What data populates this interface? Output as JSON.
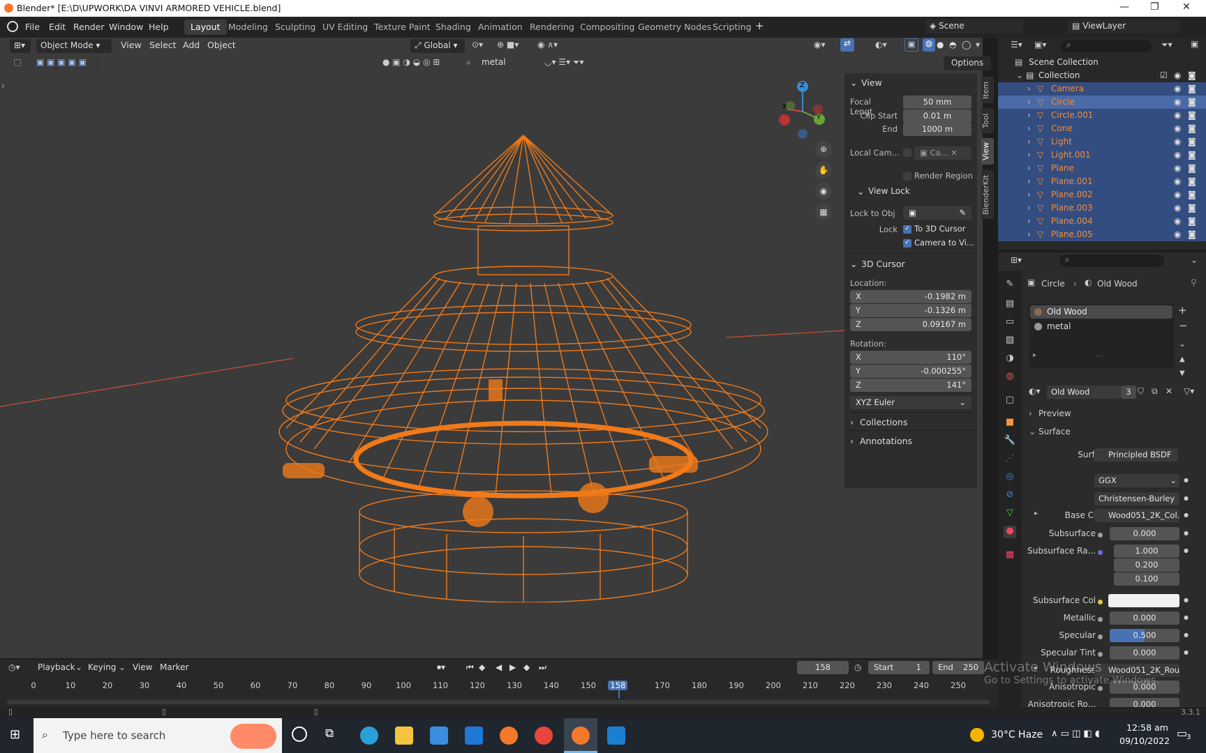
{
  "window": {
    "title": "Blender* [E:\\D\\UPWORK\\DA VINVI ARMORED VEHICLE.blend]"
  },
  "menu": [
    "File",
    "Edit",
    "Render",
    "Window",
    "Help"
  ],
  "workspaces": [
    "Layout",
    "Modeling",
    "Sculpting",
    "UV Editing",
    "Texture Paint",
    "Shading",
    "Animation",
    "Rendering",
    "Compositing",
    "Geometry Nodes",
    "Scripting"
  ],
  "scene": {
    "name": "Scene",
    "view_layer": "ViewLayer"
  },
  "viewport_header": {
    "mode": "Object Mode",
    "view": "View",
    "select": "Select",
    "add": "Add",
    "object": "Object",
    "orientation": "Global",
    "options": "Options",
    "search_value": "metal"
  },
  "npanel": {
    "view_title": "View",
    "focal_label": "Focal Lengt",
    "focal": "50 mm",
    "clip_start_label": "Clip Start",
    "clip_start": "0.01 m",
    "end_label": "End",
    "end": "1000 m",
    "local_cam_label": "Local Cam...",
    "local_cam_value": "Ca...",
    "render_region": "Render Region",
    "view_lock_title": "View Lock",
    "lock_obj_label": "Lock to Obj",
    "lock_label": "Lock",
    "to_3d_cursor": "To 3D Cursor",
    "camera_to_view": "Camera to Vi...",
    "cursor_title": "3D Cursor",
    "location_label": "Location:",
    "loc": {
      "x": "-0.1982 m",
      "y": "-0.1326 m",
      "z": "0.09167 m"
    },
    "rotation_label": "Rotation:",
    "rot": {
      "x": "110°",
      "y": "-0.000255°",
      "z": "141°"
    },
    "rot_mode": "XYZ Euler",
    "collections": "Collections",
    "annotations": "Annotations",
    "tabs": [
      "Item",
      "Tool",
      "View",
      "BlenderKit"
    ],
    "axis": {
      "x": "X",
      "y": "Y",
      "z": "Z"
    }
  },
  "outliner": {
    "scene_collection": "Scene Collection",
    "collection": "Collection",
    "items": [
      {
        "name": "Camera",
        "sel": true
      },
      {
        "name": "Circle",
        "sel": true,
        "active": true
      },
      {
        "name": "Circle.001",
        "sel": true
      },
      {
        "name": "Cone",
        "sel": true
      },
      {
        "name": "Light",
        "sel": true
      },
      {
        "name": "Light.001",
        "sel": true
      },
      {
        "name": "Plane",
        "sel": true
      },
      {
        "name": "Plane.001",
        "sel": true
      },
      {
        "name": "Plane.002",
        "sel": true
      },
      {
        "name": "Plane.003",
        "sel": true
      },
      {
        "name": "Plane.004",
        "sel": true
      },
      {
        "name": "Plane.005",
        "sel": true
      }
    ]
  },
  "properties": {
    "breadcrumb_object": "Circle",
    "breadcrumb_material": "Old Wood",
    "slots": [
      "Old Wood",
      "metal"
    ],
    "material_name": "Old Wood",
    "material_users": "3",
    "preview": "Preview",
    "surface_section": "Surface",
    "surface_label": "Surface",
    "surface_value": "Principled BSDF",
    "distribution": "GGX",
    "subsurface_method": "Christensen-Burley",
    "base_color_label": "Base Color",
    "base_color_value": "Wood051_2K_Col...",
    "subsurface_label": "Subsurface",
    "subsurface": "0.000",
    "subsurface_radius_label": "Subsurface Ra...",
    "subsurface_radius": [
      "1.000",
      "0.200",
      "0.100"
    ],
    "subsurface_col_label": "Subsurface Col",
    "metallic_label": "Metallic",
    "metallic": "0.000",
    "specular_label": "Specular",
    "specular": "0.500",
    "specular_fraction": 0.5,
    "specular_tint_label": "Specular Tint",
    "specular_tint": "0.000",
    "roughness_label": "Roughness",
    "roughness_value": "Wood051_2K_Rou...",
    "anisotropic_label": "Anisotropic",
    "anisotropic": "0.000",
    "anisotropic_rot_label": "Anisotropic Ro...",
    "anisotropic_rot": "0.000"
  },
  "timeline": {
    "playback": "Playback",
    "keying": "Keying",
    "view": "View",
    "marker": "Marker",
    "current_frame": "158",
    "start_label": "Start",
    "start": "1",
    "end_label": "End",
    "end": "250",
    "ticks": [
      "0",
      "10",
      "20",
      "30",
      "40",
      "50",
      "60",
      "70",
      "80",
      "90",
      "100",
      "110",
      "120",
      "130",
      "140",
      "150",
      "158",
      "170",
      "180",
      "190",
      "200",
      "210",
      "220",
      "230",
      "240",
      "250"
    ]
  },
  "watermark": {
    "line1": "Activate Windows",
    "line2": "Go to Settings to activate Windows."
  },
  "status": {
    "version": "3.3.1"
  },
  "taskbar": {
    "search_placeholder": "Type here to search",
    "weather": "30°C  Haze",
    "time": "12:58 am",
    "date": "09/10/2022",
    "notifications": "3"
  }
}
